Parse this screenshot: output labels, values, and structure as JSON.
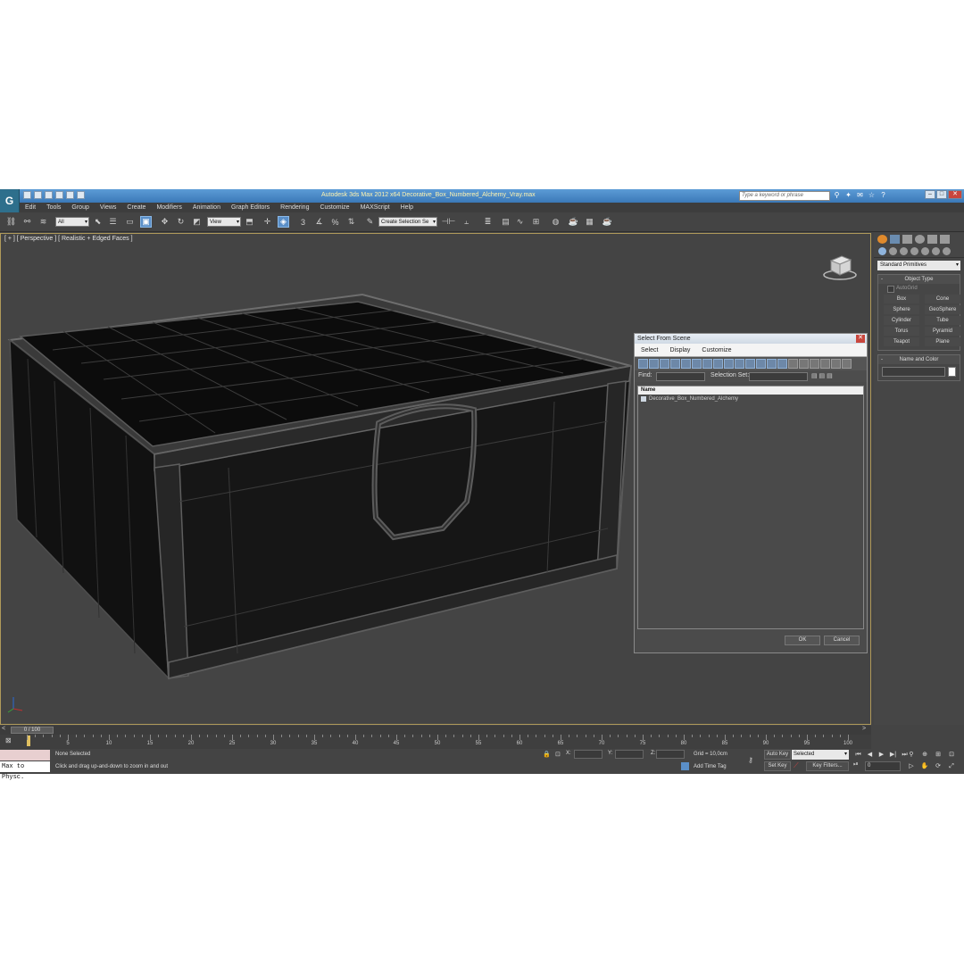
{
  "app": {
    "title": "Autodesk 3ds Max 2012 x64     Decorative_Box_Numbered_Alchemy_Vray.max",
    "search_placeholder": "Type a keyword or phrase",
    "logo_letter": "G"
  },
  "menu": [
    "Edit",
    "Tools",
    "Group",
    "Views",
    "Create",
    "Modifiers",
    "Animation",
    "Graph Editors",
    "Rendering",
    "Customize",
    "MAXScript",
    "Help"
  ],
  "toolbar": {
    "filter_value": "All",
    "refcoord_value": "View",
    "snap_label": "3",
    "named_selection_value": "Create Selection Se"
  },
  "viewport": {
    "label": "[ + ] [ Perspective ] [ Realistic + Edged Faces ]"
  },
  "dialog": {
    "title": "Select From Scene",
    "menu": [
      "Select",
      "Display",
      "Customize"
    ],
    "find_label": "Find:",
    "selection_set_label": "Selection Set:",
    "column_header": "Name",
    "rows": [
      "Decorative_Box_Numbered_Alchemy"
    ],
    "ok_label": "OK",
    "cancel_label": "Cancel"
  },
  "command_panel": {
    "dropdown_value": "Standard Primitives",
    "object_type_title": "Object Type",
    "autogrid_label": "AutoGrid",
    "primitives": [
      "Box",
      "Cone",
      "Sphere",
      "GeoSphere",
      "Cylinder",
      "Tube",
      "Torus",
      "Pyramid",
      "Teapot",
      "Plane"
    ],
    "name_color_title": "Name and Color",
    "rollout_marker": "-"
  },
  "timeline": {
    "slider_value": "0 / 100",
    "ticks": [
      "5",
      "10",
      "15",
      "20",
      "25",
      "30",
      "35",
      "40",
      "45",
      "50",
      "55",
      "60",
      "65",
      "70",
      "75",
      "80",
      "85",
      "90",
      "95",
      "100"
    ]
  },
  "status": {
    "maxscript_text": "Max to Physc.",
    "selection_status": "None Selected",
    "prompt": "Click and drag up-and-down to zoom in and out",
    "x_label": "X:",
    "y_label": "Y:",
    "z_label": "Z:",
    "grid": "Grid = 10,0cm",
    "add_time_tag": "Add Time Tag",
    "auto_key": "Auto Key",
    "set_key": "Set Key",
    "key_mode_value": "Selected",
    "key_filters": "Key Filters...",
    "frame_value": "0"
  }
}
